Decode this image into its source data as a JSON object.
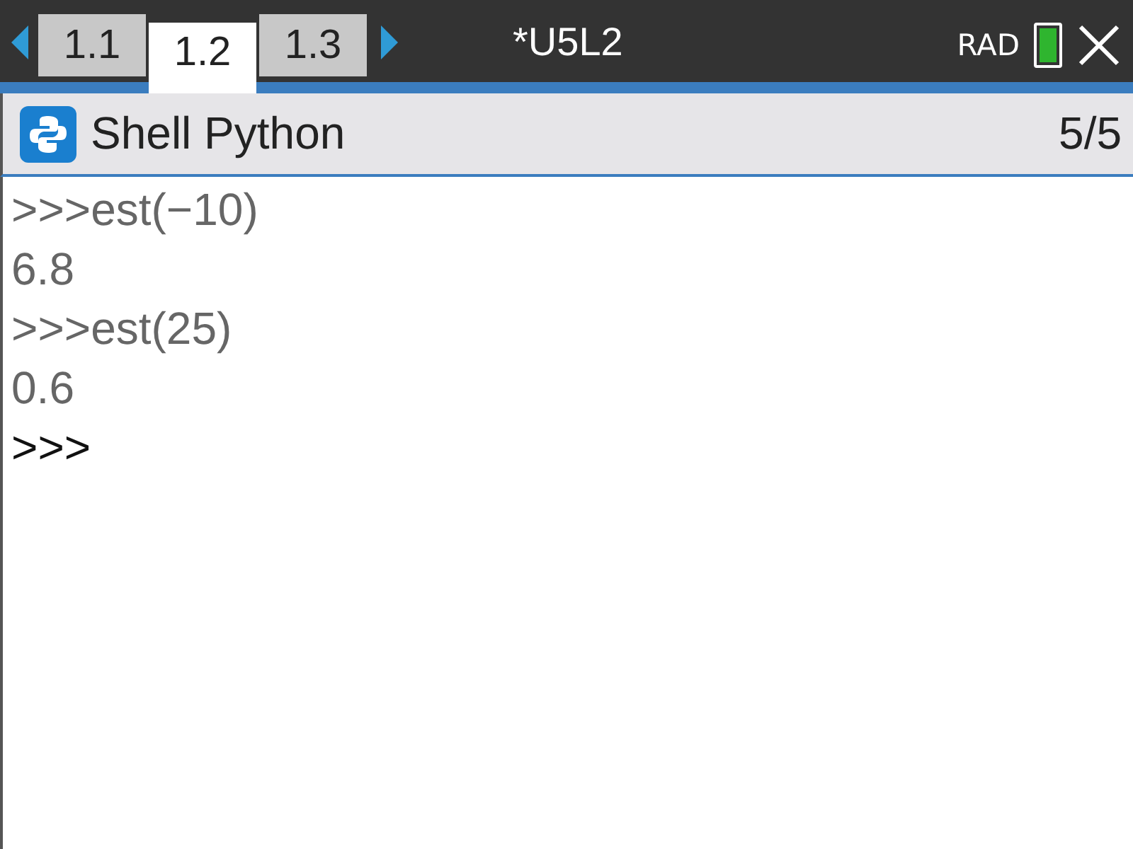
{
  "tabs": [
    {
      "label": "1.1",
      "selected": false
    },
    {
      "label": "1.2",
      "selected": true
    },
    {
      "label": "1.3",
      "selected": false
    }
  ],
  "document_title": "*U5L2",
  "angle_mode": "RAD",
  "app_header": {
    "title": "Shell Python",
    "page": "5/5"
  },
  "shell_lines": [
    {
      "kind": "input",
      "text": ">>>est(−10)"
    },
    {
      "kind": "output",
      "text": "6.8"
    },
    {
      "kind": "input",
      "text": ">>>est(25)"
    },
    {
      "kind": "output",
      "text": "0.6"
    },
    {
      "kind": "prompt",
      "text": ">>>"
    }
  ]
}
